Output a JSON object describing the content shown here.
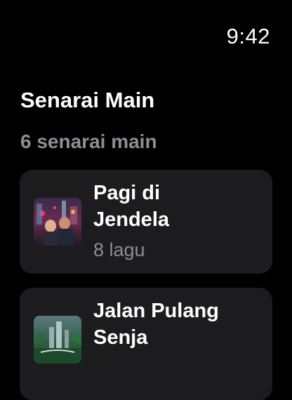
{
  "status_bar": {
    "time": "9:42"
  },
  "header": {
    "title": "Senarai Main",
    "count_label": "6 senarai main"
  },
  "playlists": [
    {
      "title": "Pagi di\nJendela",
      "subtitle": "8 lagu",
      "artwork": "city-night-couple-artwork"
    },
    {
      "title": "Jalan Pulang\nSenja",
      "subtitle": "",
      "artwork": "jungle-city-skyline-artwork"
    }
  ]
}
